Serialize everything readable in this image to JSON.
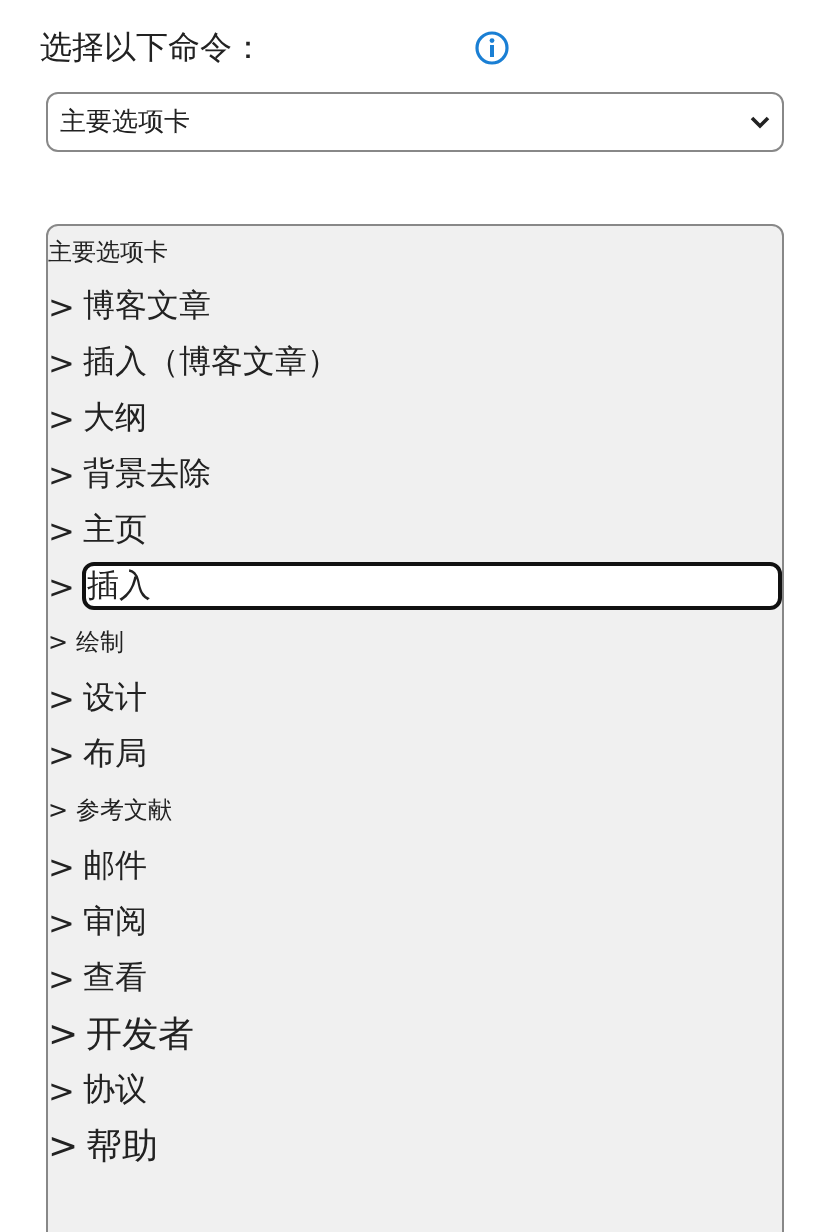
{
  "prompt": {
    "label": "选择以下命令："
  },
  "dropdown": {
    "value": "主要选项卡"
  },
  "list": {
    "header": "主要选项卡",
    "items": [
      {
        "marker": ">",
        "label": "博客文章",
        "kind": "medium",
        "selected": false
      },
      {
        "marker": ">",
        "label": "插入（博客文章）",
        "kind": "medium",
        "selected": false
      },
      {
        "marker": ">",
        "label": "大纲",
        "kind": "medium",
        "selected": false
      },
      {
        "marker": ">",
        "label": "背景去除",
        "kind": "medium",
        "selected": false
      },
      {
        "marker": ">",
        "label": "主页",
        "kind": "medium",
        "selected": false
      },
      {
        "marker": ">",
        "label": "插入",
        "kind": "medium",
        "selected": true
      },
      {
        "marker": ">",
        "label": "绘制",
        "kind": "small",
        "selected": false
      },
      {
        "marker": ">",
        "label": "设计",
        "kind": "medium",
        "selected": false
      },
      {
        "marker": ">",
        "label": "布局",
        "kind": "medium",
        "selected": false
      },
      {
        "marker": ">",
        "label": "参考文献",
        "kind": "small",
        "selected": false
      },
      {
        "marker": ">",
        "label": "邮件",
        "kind": "medium",
        "selected": false
      },
      {
        "marker": ">",
        "label": "审阅",
        "kind": "medium",
        "selected": false
      },
      {
        "marker": ">",
        "label": "查看",
        "kind": "medium",
        "selected": false
      },
      {
        "marker": ">",
        "label": "开发者",
        "kind": "large",
        "selected": false
      },
      {
        "marker": ">",
        "label": "协议",
        "kind": "medium",
        "selected": false
      },
      {
        "marker": ">",
        "label": "帮助",
        "kind": "large",
        "selected": false
      }
    ]
  }
}
